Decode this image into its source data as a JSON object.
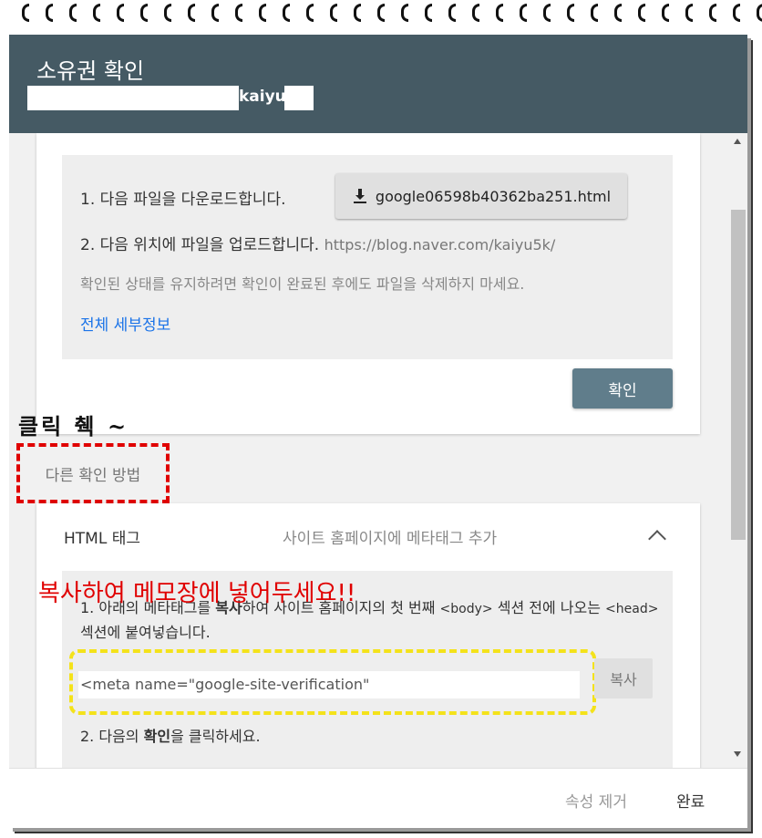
{
  "dialog": {
    "title": "소유권 확인",
    "domain_suffix": "kaiyu"
  },
  "file_method": {
    "step1": "1. 다음 파일을 다운로드합니다.",
    "download_label": "google06598b40362ba251.html",
    "step2": "2. 다음 위치에 파일을 업로드합니다.",
    "upload_url": "https://blog.naver.com/kaiyu5k/",
    "note": "확인된 상태를 유지하려면 확인이 완료된 후에도 파일을 삭제하지 마세요.",
    "details_link": "전체 세부정보",
    "confirm_label": "확인"
  },
  "annotations": {
    "click": "클릭 췍 ~",
    "copy": "복사하여 메모장에 넣어두세요!!"
  },
  "other_methods_label": "다른 확인 방법",
  "html_tag_method": {
    "title": "HTML 태그",
    "description": "사이트 홈페이지에 메타태그 추가",
    "step1_a": "1. 아래의 메타태그를 ",
    "step1_bold": "복사",
    "step1_b": "하여 사이트 홈페이지의 첫 번째 ",
    "step1_code1": "<body>",
    "step1_c": " 섹션 전에 나오는 ",
    "step1_code2": "<head>",
    "step1_d": " 섹션에 붙여넣습니다.",
    "meta_value": "<meta name=\"google-site-verification\"",
    "copy_label": "복사",
    "step2_a": "2. 다음의 ",
    "step2_bold": "확인",
    "step2_b": "을 클릭하세요."
  },
  "footer": {
    "remove_label": "속성 제거",
    "done_label": "완료"
  },
  "colors": {
    "header_bg": "#455a64",
    "confirm_bg": "#607d8b",
    "link": "#1a73e8",
    "annotation_red": "#e00000",
    "annotation_yellow": "#f4e21a"
  }
}
